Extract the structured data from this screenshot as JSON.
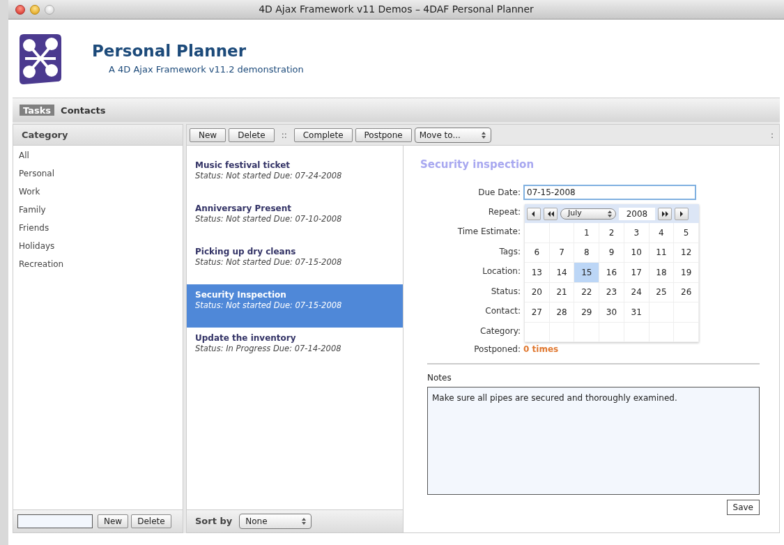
{
  "window": {
    "title": "4D Ajax Framework v11 Demos – 4DAF Personal Planner"
  },
  "header": {
    "title": "Personal Planner",
    "subtitle": "A 4D Ajax Framework v11.2 demonstration"
  },
  "tabs": [
    {
      "label": "Tasks",
      "selected": true
    },
    {
      "label": "Contacts",
      "selected": false
    }
  ],
  "sidebar": {
    "title": "Category",
    "items": [
      "All",
      "Personal",
      "Work",
      "Family",
      "Friends",
      "Holidays",
      "Recreation"
    ],
    "buttons": [
      "New",
      "Delete"
    ]
  },
  "toolbar": {
    "buttons_left": [
      "New",
      "Delete"
    ],
    "separator": "::",
    "buttons_right": [
      "Complete",
      "Postpone"
    ],
    "move_select": "Move to...",
    "end_mark": ":"
  },
  "tasks": [
    {
      "title": "Music festival ticket",
      "subtitle": "Status: Not started Due: 07-24-2008",
      "selected": false
    },
    {
      "title": "Anniversary Present",
      "subtitle": "Status: Not started Due: 07-10-2008",
      "selected": false
    },
    {
      "title": "Picking up dry cleans",
      "subtitle": "Status: Not started Due: 07-15-2008",
      "selected": false
    },
    {
      "title": "Security Inspection",
      "subtitle": "Status: Not started Due: 07-15-2008",
      "selected": true
    },
    {
      "title": "Update the inventory",
      "subtitle": "Status: In Progress Due: 07-14-2008",
      "selected": false
    }
  ],
  "sort": {
    "label": "Sort by",
    "value": "None"
  },
  "detail": {
    "title": "Security inspection",
    "due_date_label": "Due Date:",
    "due_date": "07-15-2008",
    "labels": [
      "Repeat:",
      "Time Estimate:",
      "Tags:",
      "Location:",
      "Status:",
      "Contact:",
      "Category:"
    ],
    "postponed_label": "Postponed:",
    "postponed": "0 times",
    "notes_label": "Notes",
    "notes": "Make sure all pipes are secured and thoroughly examined.",
    "save": "Save"
  },
  "calendar": {
    "month": "July",
    "year": "2008",
    "weeks": [
      [
        {
          "kind": "blank"
        },
        {
          "kind": "blank"
        },
        {
          "kind": "day",
          "day": "1",
          "selected": false
        },
        {
          "kind": "day",
          "day": "2",
          "selected": false
        },
        {
          "kind": "day",
          "day": "3",
          "selected": false
        },
        {
          "kind": "day",
          "day": "4",
          "selected": false
        },
        {
          "kind": "day",
          "day": "5",
          "selected": false
        }
      ],
      [
        {
          "kind": "day",
          "day": "6",
          "selected": false
        },
        {
          "kind": "day",
          "day": "7",
          "selected": false
        },
        {
          "kind": "day",
          "day": "8",
          "selected": false
        },
        {
          "kind": "day",
          "day": "9",
          "selected": false
        },
        {
          "kind": "day",
          "day": "10",
          "selected": false
        },
        {
          "kind": "day",
          "day": "11",
          "selected": false
        },
        {
          "kind": "day",
          "day": "12",
          "selected": false
        }
      ],
      [
        {
          "kind": "day",
          "day": "13",
          "selected": false
        },
        {
          "kind": "day",
          "day": "14",
          "selected": false
        },
        {
          "kind": "day",
          "day": "15",
          "selected": true
        },
        {
          "kind": "day",
          "day": "16",
          "selected": false
        },
        {
          "kind": "day",
          "day": "17",
          "selected": false
        },
        {
          "kind": "day",
          "day": "18",
          "selected": false
        },
        {
          "kind": "day",
          "day": "19",
          "selected": false
        }
      ],
      [
        {
          "kind": "day",
          "day": "20",
          "selected": false
        },
        {
          "kind": "day",
          "day": "21",
          "selected": false
        },
        {
          "kind": "day",
          "day": "22",
          "selected": false
        },
        {
          "kind": "day",
          "day": "23",
          "selected": false
        },
        {
          "kind": "day",
          "day": "24",
          "selected": false
        },
        {
          "kind": "day",
          "day": "25",
          "selected": false
        },
        {
          "kind": "day",
          "day": "26",
          "selected": false
        }
      ],
      [
        {
          "kind": "day",
          "day": "27",
          "selected": false
        },
        {
          "kind": "day",
          "day": "28",
          "selected": false
        },
        {
          "kind": "day",
          "day": "29",
          "selected": false
        },
        {
          "kind": "day",
          "day": "30",
          "selected": false
        },
        {
          "kind": "day",
          "day": "31",
          "selected": false
        },
        {
          "kind": "blank"
        },
        {
          "kind": "blank"
        }
      ],
      [
        {
          "kind": "blank"
        },
        {
          "kind": "blank"
        },
        {
          "kind": "blank"
        },
        {
          "kind": "blank"
        },
        {
          "kind": "blank"
        },
        {
          "kind": "blank"
        },
        {
          "kind": "blank"
        }
      ]
    ]
  }
}
